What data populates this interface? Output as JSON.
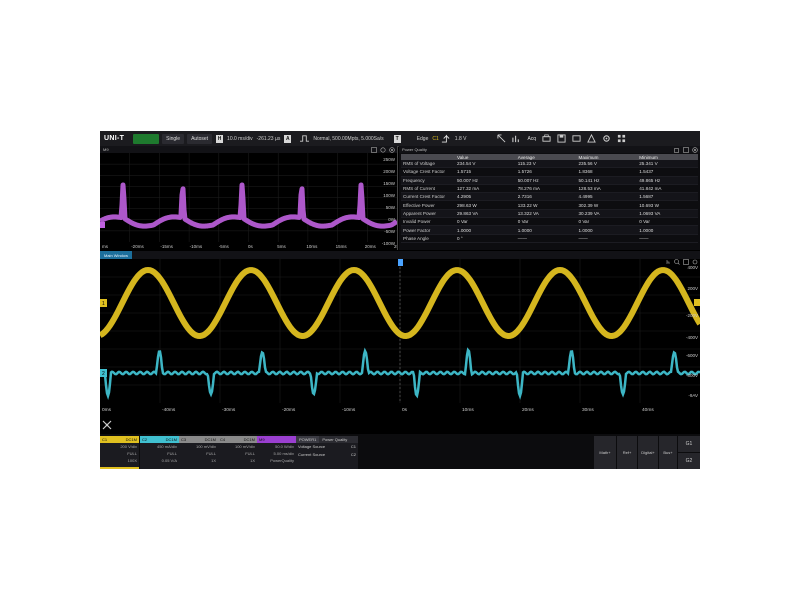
{
  "toolbar": {
    "logo": "UNI-T",
    "run_label": "",
    "single_label": "Single",
    "autoset_label": "Autoset",
    "h_key": "H",
    "timebase": "10.0 ms/div",
    "offset": "-261.23 µs",
    "a_key": "A",
    "acq_mode": "Normal,  500.00Mpts,  5.000Sa/s",
    "t_key": "T",
    "trigger_type": "Edge",
    "trigger_source": "C1",
    "trigger_level": "1.8 V",
    "acq_label": "Acq",
    "icons": [
      "cursor-icon",
      "measure-icon",
      "acq-icon",
      "print-icon",
      "save-icon",
      "display-icon",
      "utility-icon",
      "settings-icon",
      "apps-icon"
    ]
  },
  "math_pane": {
    "name": "M9",
    "y_labels": [
      "250W",
      "200W",
      "150W",
      "100W",
      "50W",
      "0W",
      "-50W",
      "-100W"
    ],
    "x_labels": [
      "ms",
      "-20ms",
      "-15ms",
      "-10ms",
      "-5ms",
      "0s",
      "5ms",
      "10ms",
      "15ms",
      "20ms",
      "25"
    ],
    "trace_color": "#c060e0"
  },
  "power_quality": {
    "title": "Power Quality",
    "headers": [
      "",
      "Value",
      "Average",
      "Maximum",
      "Minimum"
    ],
    "rows": [
      [
        "RMS of Voltage",
        "234.54 V",
        "115.23 V",
        "235.56 V",
        "25.341 V"
      ],
      [
        "Voltage Crest Factor",
        "1.5715",
        "1.5726",
        "1.8368",
        "1.5437"
      ],
      [
        "Frequency",
        "50.007 Hz",
        "50.007 Hz",
        "50.141 Hz",
        "49.865 Hz"
      ],
      [
        "RMS of Current",
        "127.32 mA",
        "78.276 mA",
        "128.53 mA",
        "41.842 mA"
      ],
      [
        "Current Crest Factor",
        "4.2905",
        "2.7316",
        "4.4995",
        "1.5687"
      ],
      [
        "Effective Power",
        "298.63 W",
        "133.22 W",
        "302.39 W",
        "10.693 W"
      ],
      [
        "Apparent Power",
        "29.863 VA",
        "13.322 VA",
        "30.239 VA",
        "1.0693 VA"
      ],
      [
        "Invalid Power",
        "0 Var",
        "0 Var",
        "0 Var",
        "0 Var"
      ],
      [
        "Power Factor",
        "1.0000",
        "1.0000",
        "1.0000",
        "1.0000"
      ],
      [
        "Phase Angle",
        "0 °",
        "——",
        "——",
        "——"
      ]
    ]
  },
  "main_window": {
    "tab": "Main Window",
    "y_labels_ch1": [
      "400V",
      "200V",
      "-200V",
      "-400V"
    ],
    "y_labels_ch2": [
      "-600V",
      "-800V",
      "-9AV"
    ],
    "x_labels": [
      "0ms",
      "-40ms",
      "-30ms",
      "-20ms",
      "-10ms",
      "0s",
      "10ms",
      "20ms",
      "30ms",
      "40ms"
    ],
    "ch1_color": "#e0c020",
    "ch2_color": "#40c0d0",
    "marker_ch1": "1",
    "marker_ch2": "2"
  },
  "channels": [
    {
      "name": "C1",
      "coupling": "DC1M",
      "scale": "200 V/div",
      "bw": "FULL",
      "probe": "100X",
      "color": "#e0c020"
    },
    {
      "name": "C2",
      "coupling": "DC1M",
      "scale": "450 mA/div",
      "bw": "FULL",
      "probe": "0.05 V/A",
      "color": "#40c0d0"
    },
    {
      "name": "C3",
      "coupling": "DC1M",
      "scale": "100 mV/div",
      "bw": "FULL",
      "probe": "1X",
      "color": "#8a8a8a"
    },
    {
      "name": "C4",
      "coupling": "DC1M",
      "scale": "100 mV/div",
      "bw": "FULL",
      "probe": "1X",
      "color": "#8a8a8a"
    },
    {
      "name": "M9",
      "coupling": "",
      "scale": "50.0 W/div",
      "bw": "5.00 ms/div",
      "probe": "PowerQuality",
      "color": "#9a3fd0"
    }
  ],
  "power_panel": {
    "tab": "POWER1",
    "mode": "Power Quality",
    "voltage_label": "Voltage Source",
    "voltage_value": "C1",
    "current_label": "Current Source",
    "current_value": "C2"
  },
  "right_buttons": {
    "math": "Math+",
    "ref": "Ref+",
    "digital": "Digital+",
    "bus": "Bus+",
    "g1": "G1",
    "g2": "G2"
  }
}
